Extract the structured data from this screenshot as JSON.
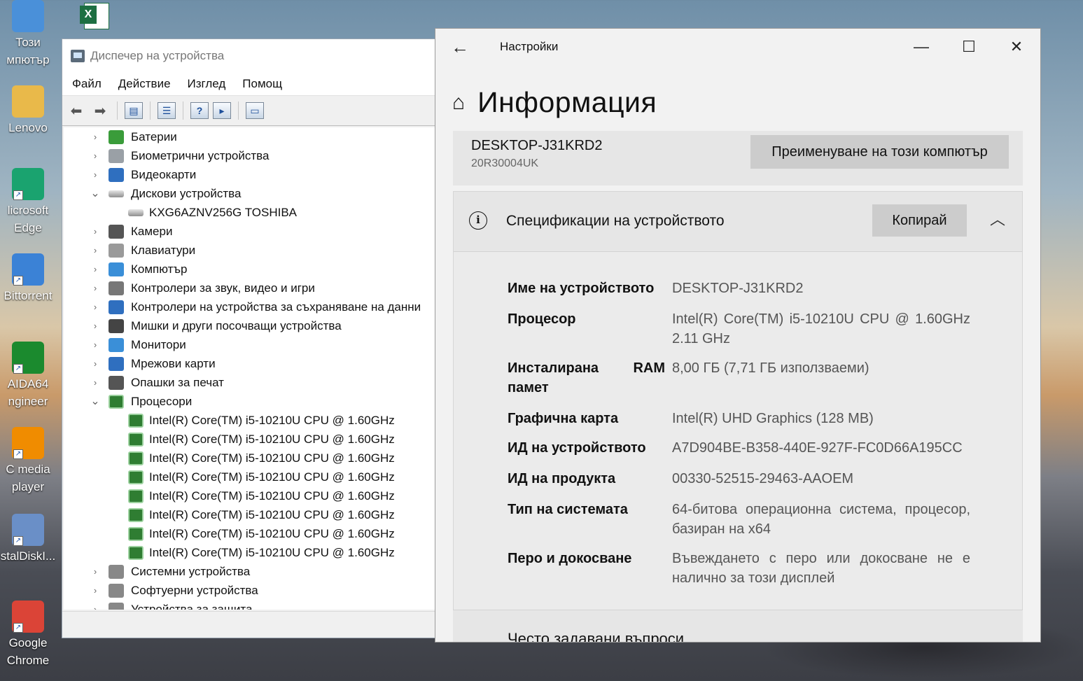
{
  "desktop": {
    "icons": [
      {
        "label_1": "Този",
        "label_2": "мпютър",
        "name": "this-pc-icon",
        "color": "#4a90d9"
      },
      {
        "label_1": "Lenovo",
        "label_2": "",
        "name": "user-folder-icon",
        "color": "#e9b94a"
      },
      {
        "label_1": "licrosoft",
        "label_2": "Edge",
        "name": "edge-icon",
        "color": "#1aa36f"
      },
      {
        "label_1": "Bittorrent",
        "label_2": "",
        "name": "qbittorrent-icon",
        "color": "#3b82d6"
      },
      {
        "label_1": "AIDA64",
        "label_2": "ngineer",
        "name": "aida64-icon",
        "color": "#1b8a2e"
      },
      {
        "label_1": "C media",
        "label_2": "player",
        "name": "vlc-icon",
        "color": "#f08c00"
      },
      {
        "label_1": "stalDiskI...",
        "label_2": "",
        "name": "crystaldiskinfo-icon",
        "color": "#6a8fc7"
      },
      {
        "label_1": "Google",
        "label_2": "Chrome",
        "name": "chrome-icon",
        "color": "#db4437"
      }
    ],
    "excel_icon": "excel-icon"
  },
  "device_manager": {
    "title": "Диспечер на устройства",
    "menu": [
      "Файл",
      "Действие",
      "Изглед",
      "Помощ"
    ],
    "tree": [
      {
        "label": "Батерии",
        "expanded": false
      },
      {
        "label": "Биометрични устройства",
        "expanded": false
      },
      {
        "label": "Видеокарти",
        "expanded": false
      },
      {
        "label": "Дискови устройства",
        "expanded": true
      },
      {
        "label": "KXG6AZNV256G TOSHIBA",
        "child": true
      },
      {
        "label": "Камери",
        "expanded": false
      },
      {
        "label": "Клавиатури",
        "expanded": false
      },
      {
        "label": "Компютър",
        "expanded": false
      },
      {
        "label": "Контролери за звук, видео и игри",
        "expanded": false
      },
      {
        "label": "Контролери на устройства за съхраняване на данни",
        "expanded": false
      },
      {
        "label": "Мишки и други посочващи устройства",
        "expanded": false
      },
      {
        "label": "Монитори",
        "expanded": false
      },
      {
        "label": "Мрежови карти",
        "expanded": false
      },
      {
        "label": "Опашки за печат",
        "expanded": false
      },
      {
        "label": "Процесори",
        "expanded": true
      },
      {
        "label": "Intel(R) Core(TM) i5-10210U CPU @ 1.60GHz",
        "child": true
      },
      {
        "label": "Intel(R) Core(TM) i5-10210U CPU @ 1.60GHz",
        "child": true
      },
      {
        "label": "Intel(R) Core(TM) i5-10210U CPU @ 1.60GHz",
        "child": true
      },
      {
        "label": "Intel(R) Core(TM) i5-10210U CPU @ 1.60GHz",
        "child": true
      },
      {
        "label": "Intel(R) Core(TM) i5-10210U CPU @ 1.60GHz",
        "child": true
      },
      {
        "label": "Intel(R) Core(TM) i5-10210U CPU @ 1.60GHz",
        "child": true
      },
      {
        "label": "Intel(R) Core(TM) i5-10210U CPU @ 1.60GHz",
        "child": true
      },
      {
        "label": "Intel(R) Core(TM) i5-10210U CPU @ 1.60GHz",
        "child": true
      },
      {
        "label": "Системни устройства",
        "expanded": false
      },
      {
        "label": "Софтуерни устройства",
        "expanded": false
      },
      {
        "label": "Устройства за защита",
        "expanded": false
      }
    ]
  },
  "settings": {
    "app_title": "Настройки",
    "page_title": "Информация",
    "pc_name": "DESKTOP-J31KRD2",
    "pc_model": "20R30004UK",
    "rename_button": "Преименуване на този компютър",
    "spec_section_title": "Спецификации на устройството",
    "copy_button": "Копирай",
    "specs": [
      {
        "key": "Име на устройството",
        "value": "DESKTOP-J31KRD2"
      },
      {
        "key": "Процесор",
        "value": "Intel(R) Core(TM) i5-10210U CPU @ 1.60GHz 2.11 GHz"
      },
      {
        "key": "Инсталирана RAM памет",
        "value": "8,00 ГБ (7,71 ГБ използваеми)"
      },
      {
        "key": "Графична карта",
        "value": "Intel(R) UHD Graphics (128 MB)"
      },
      {
        "key": "ИД на устройството",
        "value": "A7D904BE-B358-440E-927F-FC0D66A195CC"
      },
      {
        "key": "ИД на продукта",
        "value": "00330-52515-29463-AAOEM"
      },
      {
        "key": "Тип на системата",
        "value": "64-битова операционна система, процесор, базиран на x64"
      },
      {
        "key": "Перо и докосване",
        "value": "Въвеждането с перо или докосване не е налично за този дисплей"
      }
    ],
    "faq_title": "Често задавани въпроси"
  }
}
